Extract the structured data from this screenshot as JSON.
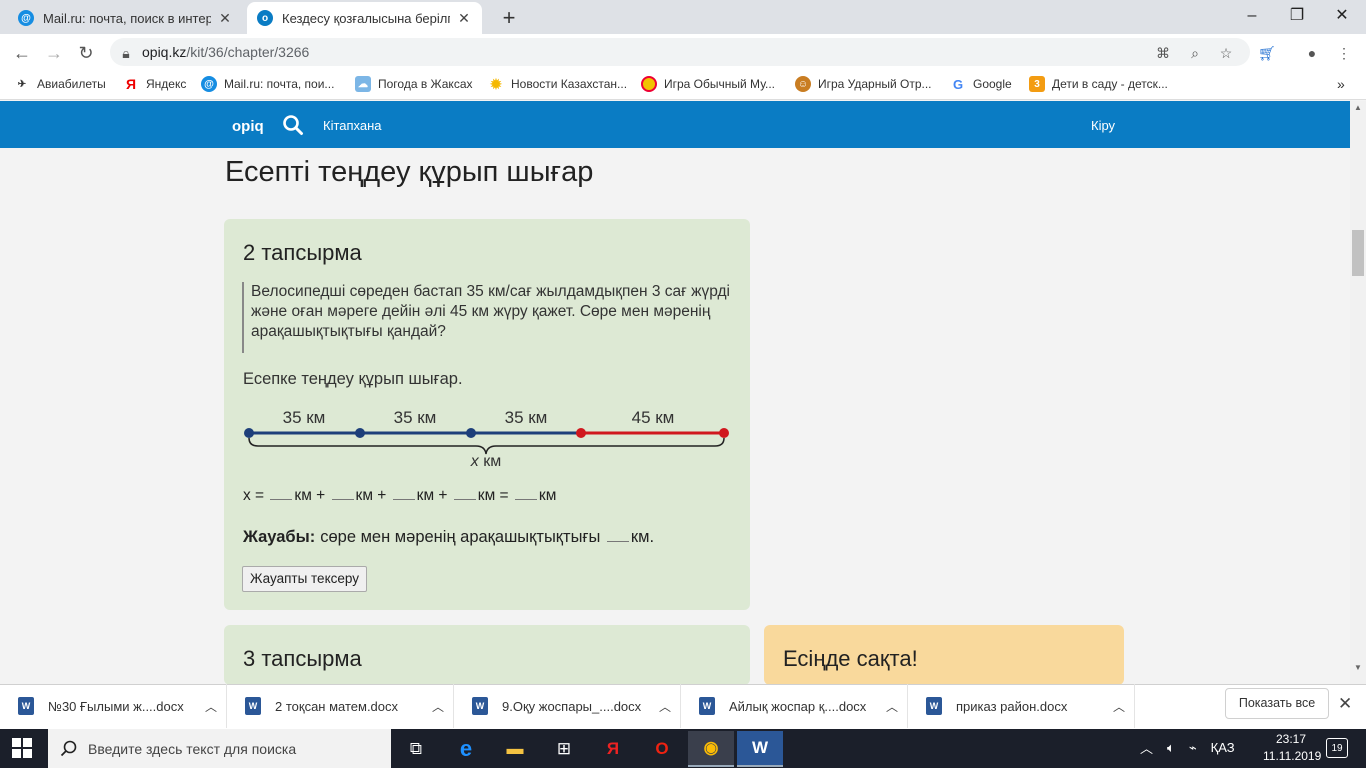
{
  "browser": {
    "tabs": [
      {
        "title": "Mail.ru: почта, поиск в интернете",
        "active": false
      },
      {
        "title": "Кездесу қозғалысына берілген есептер",
        "active": true
      }
    ],
    "url_host": "opiq.kz",
    "url_path": "/kit/36/chapter/3266",
    "bookmarks": [
      "Авиабилеты",
      "Яндекс",
      "Mail.ru: почта, пои...",
      "Погода в Жаксах",
      "Новости Казахстан...",
      "Игра Обычный Му...",
      "Игра Ударный Отр...",
      "Google",
      "Дети в саду - детск..."
    ]
  },
  "site": {
    "logo": "opiq",
    "nav_library": "Кітапхана",
    "nav_login": "Кіру"
  },
  "page": {
    "title": "Есепті теңдеу құрып шығар",
    "task2": {
      "title": "2 тапсырма",
      "problem": "Велосипедші сөреден бастап 35 км/сағ жылдамдықпен 3 сағ жүрді және оған мәреге дейін әлі 45 км жүру қажет. Сөре мен мәренің арақашықтықтығы қандай?",
      "instruction": "Есепке теңдеу құрып шығар.",
      "diagram": {
        "segments": [
          "35 км",
          "35 км",
          "35 км",
          "45 км"
        ],
        "total_var": "x",
        "total_unit": "км",
        "colors": {
          "blue": "#1d3f7a",
          "red": "#d0181e"
        }
      },
      "equation": {
        "lhs": "x =",
        "unit": "км",
        "plus": "+",
        "equals": "="
      },
      "answer_label": "Жауабы:",
      "answer_text": "сөре мен мәренің арақашықтықтығы",
      "answer_unit": "км.",
      "check_button": "Жауапты тексеру"
    },
    "task3": {
      "title": "3 тапсырма"
    },
    "remember": {
      "title": "Есіңде сақта!"
    }
  },
  "downloads": {
    "items": [
      "№30  Ғылыми ж....docx",
      "2 тоқсан матем.docx",
      "9.Оқу жоспары_....docx",
      "Айлық жоспар қ....docx",
      "приказ район.docx"
    ],
    "show_all": "Показать все"
  },
  "taskbar": {
    "search_placeholder": "Введите здесь текст для поиска",
    "lang": "ҚАЗ",
    "time": "23:17",
    "date": "11.11.2019",
    "notifications": "19"
  }
}
